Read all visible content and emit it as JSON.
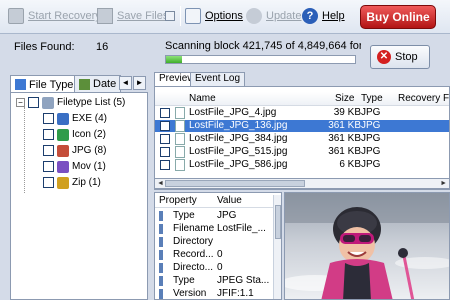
{
  "toolbar": {
    "start_recovery": "Start Recovery",
    "save_files": "Save Files",
    "options": "Options",
    "update": "Update",
    "help": "Help",
    "buy_online": "Buy Online"
  },
  "status": {
    "files_found_label": "Files Found:",
    "files_found_value": "16",
    "scan_text": "Scanning block 421,745 of 4,849,664 for lost files",
    "progress_fraction": 0.087,
    "stop_label": "Stop"
  },
  "left_tabs": {
    "file_type": "File Type",
    "date": "Date",
    "prev_arrow": "◄",
    "next_arrow": "►"
  },
  "tree": {
    "root": "Filetype List (5)",
    "items": [
      {
        "label": "EXE (4)",
        "color": "#3a6fc4"
      },
      {
        "label": "Icon (2)",
        "color": "#2f9c4a"
      },
      {
        "label": "JPG (8)",
        "color": "#c44d3a"
      },
      {
        "label": "Mov (1)",
        "color": "#7a4fc2"
      },
      {
        "label": "Zip (1)",
        "color": "#d0a020"
      }
    ]
  },
  "right_tabs": {
    "preview": "Preview",
    "event_log": "Event Log"
  },
  "filelist": {
    "headers": {
      "name": "Name",
      "size": "Size",
      "type": "Type",
      "recovery": "Recovery F"
    },
    "rows": [
      {
        "name": "LostFile_JPG_4.jpg",
        "size": "39 KB",
        "type": "JPG"
      },
      {
        "name": "LostFile_JPG_136.jpg",
        "size": "361 KB",
        "type": "JPG"
      },
      {
        "name": "LostFile_JPG_384.jpg",
        "size": "361 KB",
        "type": "JPG"
      },
      {
        "name": "LostFile_JPG_515.jpg",
        "size": "361 KB",
        "type": "JPG"
      },
      {
        "name": "LostFile_JPG_586.jpg",
        "size": "6 KB",
        "type": "JPG"
      }
    ],
    "selected_index": 1
  },
  "properties": {
    "headers": {
      "property": "Property",
      "value": "Value"
    },
    "rows": [
      {
        "key": "Type",
        "value": "JPG"
      },
      {
        "key": "Filename",
        "value": "LostFile_..."
      },
      {
        "key": "Directory",
        "value": ""
      },
      {
        "key": "Record...",
        "value": "0"
      },
      {
        "key": "Directo...",
        "value": "0"
      },
      {
        "key": "Type",
        "value": "JPEG Sta..."
      },
      {
        "key": "Version",
        "value": "JFIF:1.1"
      }
    ]
  },
  "colors": {
    "accent": "#3d78d3",
    "buy_red": "#c41c1c",
    "progress_green": "#3fae2a"
  }
}
